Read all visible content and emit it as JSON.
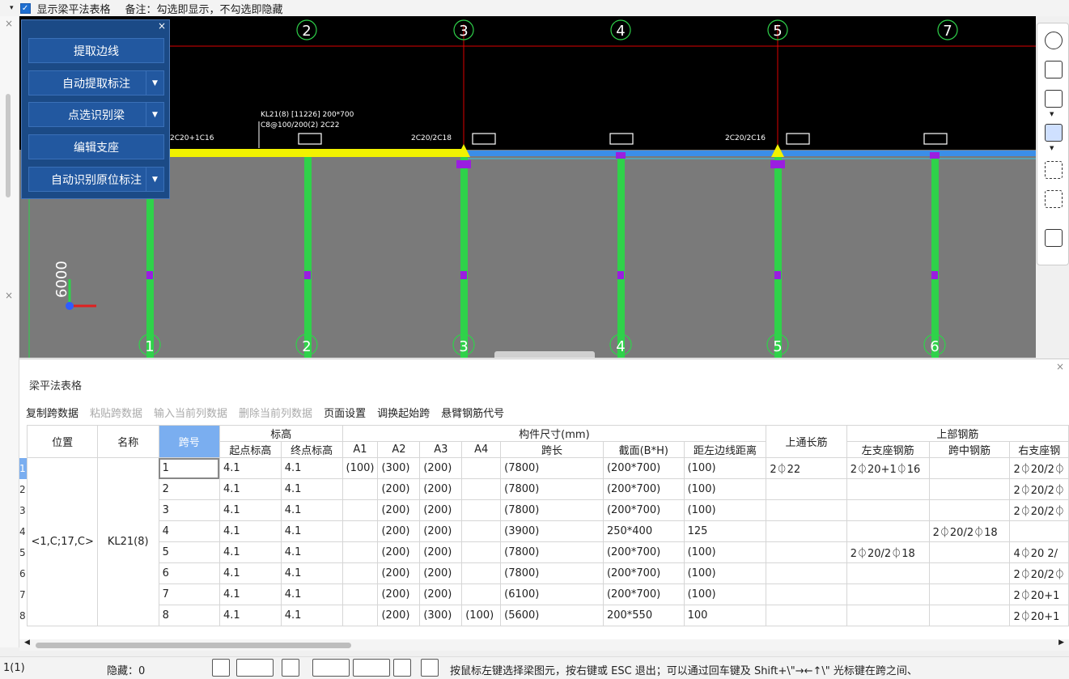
{
  "topbar": {
    "show_label": "显示梁平法表格",
    "note": "备注：勾选即显示，不勾选即隐藏"
  },
  "floatpanel": {
    "buttons": [
      {
        "label": "提取边线",
        "dropdown": false
      },
      {
        "label": "自动提取标注",
        "dropdown": true
      },
      {
        "label": "点选识别梁",
        "dropdown": true
      },
      {
        "label": "编辑支座",
        "dropdown": false
      },
      {
        "label": "自动识别原位标注",
        "dropdown": true
      }
    ]
  },
  "cad": {
    "top_axes": [
      "2",
      "3",
      "4",
      "5",
      "7"
    ],
    "bottom_axes": [
      "1",
      "2",
      "3",
      "4",
      "5",
      "6"
    ],
    "beam_label_1": "KL21(8) [11226] 200*700",
    "beam_label_2": "C8@100/200(2) 2C22",
    "dim_label": "6000",
    "notes": [
      "2C20+1C16",
      "2C20/2C18",
      "2C20/2C16"
    ]
  },
  "table": {
    "title": "梁平法表格",
    "tools": [
      {
        "label": "复制跨数据",
        "disabled": false
      },
      {
        "label": "粘贴跨数据",
        "disabled": true
      },
      {
        "label": "输入当前列数据",
        "disabled": true
      },
      {
        "label": "删除当前列数据",
        "disabled": true
      },
      {
        "label": "页面设置",
        "disabled": false
      },
      {
        "label": "调换起始跨",
        "disabled": false
      },
      {
        "label": "悬臂钢筋代号",
        "disabled": false
      }
    ],
    "headers": {
      "position": "位置",
      "name": "名称",
      "span": "跨号",
      "elevation": "标高",
      "start_elev": "起点标高",
      "end_elev": "终点标高",
      "size_group": "构件尺寸(mm)",
      "a1": "A1",
      "a2": "A2",
      "a3": "A3",
      "a4": "A4",
      "span_len": "跨长",
      "section": "截面(B*H)",
      "dist": "距左边线距离",
      "top_through": "上通长筋",
      "top_group": "上部钢筋",
      "left_seat": "左支座钢筋",
      "mid_span": "跨中钢筋",
      "right_seat": "右支座钢"
    },
    "position_value": "<1,C;17,C>",
    "name_value": "KL21(8)",
    "rows": [
      {
        "n": "1",
        "span": "1",
        "s": "4.1",
        "e": "4.1",
        "a1": "(100)",
        "a2": "(300)",
        "a3": "(200)",
        "a4": "",
        "len": "(7800)",
        "sec": "(200*700)",
        "dist": "(100)",
        "top": "2⏀22",
        "left": "2⏀20+1⏀16",
        "mid": "",
        "right": "2⏀20/2⏀"
      },
      {
        "n": "2",
        "span": "2",
        "s": "4.1",
        "e": "4.1",
        "a1": "",
        "a2": "(200)",
        "a3": "(200)",
        "a4": "",
        "len": "(7800)",
        "sec": "(200*700)",
        "dist": "(100)",
        "top": "",
        "left": "",
        "mid": "",
        "right": "2⏀20/2⏀"
      },
      {
        "n": "3",
        "span": "3",
        "s": "4.1",
        "e": "4.1",
        "a1": "",
        "a2": "(200)",
        "a3": "(200)",
        "a4": "",
        "len": "(7800)",
        "sec": "(200*700)",
        "dist": "(100)",
        "top": "",
        "left": "",
        "mid": "",
        "right": "2⏀20/2⏀"
      },
      {
        "n": "4",
        "span": "4",
        "s": "4.1",
        "e": "4.1",
        "a1": "",
        "a2": "(200)",
        "a3": "(200)",
        "a4": "",
        "len": "(3900)",
        "sec": "250*400",
        "dist": "125",
        "top": "",
        "left": "",
        "mid": "2⏀20/2⏀18",
        "right": ""
      },
      {
        "n": "5",
        "span": "5",
        "s": "4.1",
        "e": "4.1",
        "a1": "",
        "a2": "(200)",
        "a3": "(200)",
        "a4": "",
        "len": "(7800)",
        "sec": "(200*700)",
        "dist": "(100)",
        "top": "",
        "left": "2⏀20/2⏀18",
        "mid": "",
        "right": "4⏀20 2/"
      },
      {
        "n": "6",
        "span": "6",
        "s": "4.1",
        "e": "4.1",
        "a1": "",
        "a2": "(200)",
        "a3": "(200)",
        "a4": "",
        "len": "(7800)",
        "sec": "(200*700)",
        "dist": "(100)",
        "top": "",
        "left": "",
        "mid": "",
        "right": "2⏀20/2⏀"
      },
      {
        "n": "7",
        "span": "7",
        "s": "4.1",
        "e": "4.1",
        "a1": "",
        "a2": "(200)",
        "a3": "(200)",
        "a4": "",
        "len": "(6100)",
        "sec": "(200*700)",
        "dist": "(100)",
        "top": "",
        "left": "",
        "mid": "",
        "right": "2⏀20+1"
      },
      {
        "n": "8",
        "span": "8",
        "s": "4.1",
        "e": "4.1",
        "a1": "",
        "a2": "(200)",
        "a3": "(300)",
        "a4": "(100)",
        "len": "(5600)",
        "sec": "200*550",
        "dist": "100",
        "top": "",
        "left": "",
        "mid": "",
        "right": "2⏀20+1"
      }
    ]
  },
  "status": {
    "count": "1(1)",
    "hidden": "隐藏：0",
    "hint": "按鼠标左键选择梁图元，按右键或 ESC 退出；可以通过回车键及 Shift+\\\"→←↑\\\" 光标键在跨之间、"
  }
}
